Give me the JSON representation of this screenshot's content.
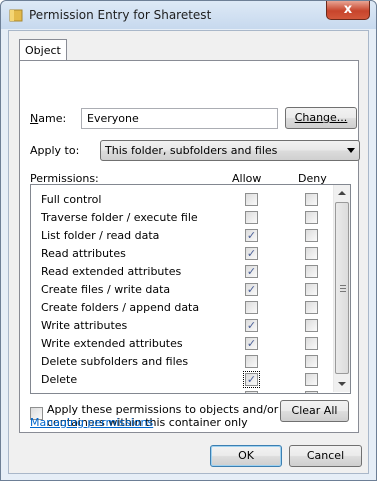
{
  "window": {
    "title": "Permission Entry for Sharetest",
    "close_glyph": "x",
    "icon": "folder-icon"
  },
  "tab": {
    "label": "Object"
  },
  "name": {
    "label_prefix": "N",
    "label_rest": "ame:",
    "value": "Everyone",
    "change_button": "Change..."
  },
  "apply_to": {
    "label": "Apply to:",
    "selected": "This folder, subfolders and files"
  },
  "permissions": {
    "header": "Permissions:",
    "allow_header": "Allow",
    "deny_header": "Deny",
    "rows": [
      {
        "name": "Full control",
        "allow": false,
        "deny": false
      },
      {
        "name": "Traverse folder / execute file",
        "allow": false,
        "deny": false
      },
      {
        "name": "List folder / read data",
        "allow": true,
        "deny": false
      },
      {
        "name": "Read attributes",
        "allow": true,
        "deny": false
      },
      {
        "name": "Read extended attributes",
        "allow": true,
        "deny": false
      },
      {
        "name": "Create files / write data",
        "allow": true,
        "deny": false
      },
      {
        "name": "Create folders / append data",
        "allow": false,
        "deny": false
      },
      {
        "name": "Write attributes",
        "allow": true,
        "deny": false
      },
      {
        "name": "Write extended attributes",
        "allow": true,
        "deny": false
      },
      {
        "name": "Delete subfolders and files",
        "allow": false,
        "deny": false
      },
      {
        "name": "Delete",
        "allow": true,
        "deny": false
      },
      {
        "name": "",
        "allow": false,
        "deny": false
      }
    ]
  },
  "apply_container": {
    "line1": "Apply these permissions to objects and/or",
    "line2": "containers within this container only",
    "checked": false,
    "clear_all_button": "Clear All"
  },
  "managing_link": "Managing permissions",
  "footer": {
    "ok": "OK",
    "cancel": "Cancel"
  },
  "colors": {
    "link": "#0066cc",
    "check": "#4a5f97",
    "close": "#c7452c"
  }
}
